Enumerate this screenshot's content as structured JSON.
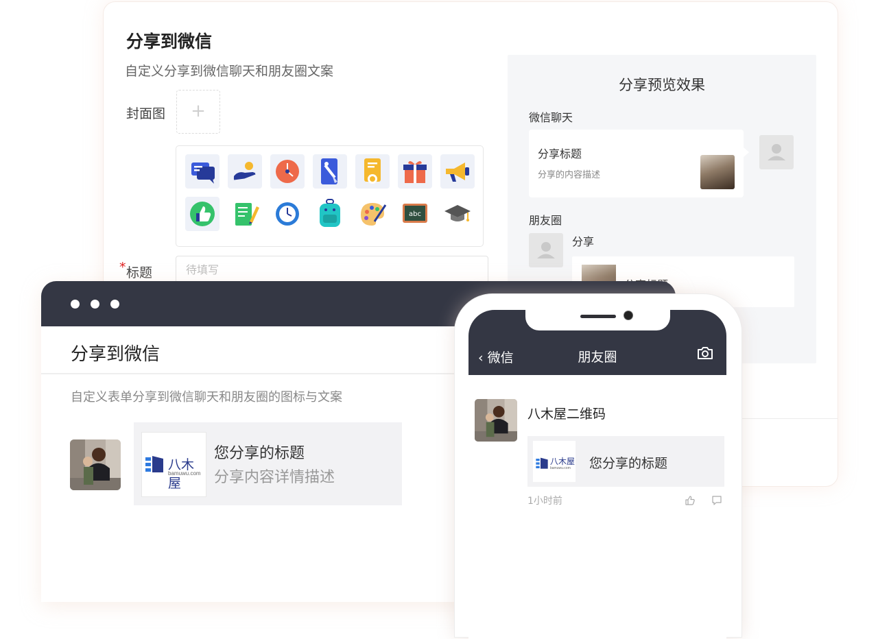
{
  "settings": {
    "title": "分享到微信",
    "subtitle": "自定义分享到微信聊天和朋友圈文案",
    "cover_label": "封面图",
    "upload_plus": "+",
    "title_required_mark": "*",
    "title_label": "标题",
    "title_placeholder": "待填写",
    "icon_options": [
      "chat-bubbles-icon",
      "hand-coin-icon",
      "clock-orange-icon",
      "tool-card-icon",
      "certificate-icon",
      "gift-icon",
      "megaphone-icon",
      "thumbs-up-icon",
      "notepad-pencil-icon",
      "alarm-clock-icon",
      "backpack-icon",
      "paint-palette-icon",
      "chalkboard-abc-icon",
      "graduation-cap-icon"
    ]
  },
  "preview": {
    "title": "分享预览效果",
    "chat_label": "微信聊天",
    "bubble_title": "分享标题",
    "bubble_desc": "分享的内容描述",
    "moments_label": "朋友圈",
    "moments_text": "分享",
    "moments_card_title": "分享标题"
  },
  "desktop": {
    "title": "分享到微信",
    "subtitle": "自定义表单分享到微信聊天和朋友圈的图标与文案",
    "card_title": "您分享的标题",
    "card_desc": "分享内容详情描述",
    "logo_cn": "八木屋",
    "logo_en": "bamuwu.com"
  },
  "phone": {
    "back_label": "微信",
    "nav_title": "朋友圈",
    "poster_name": "八木屋二维码",
    "card_title": "您分享的标题",
    "time": "1小时前",
    "logo_cn": "八木屋",
    "logo_en": "bamuwu.com"
  },
  "colors": {
    "dark_bar": "#343744",
    "accent_blue": "#3b5bdb",
    "required_red": "#e02020"
  }
}
